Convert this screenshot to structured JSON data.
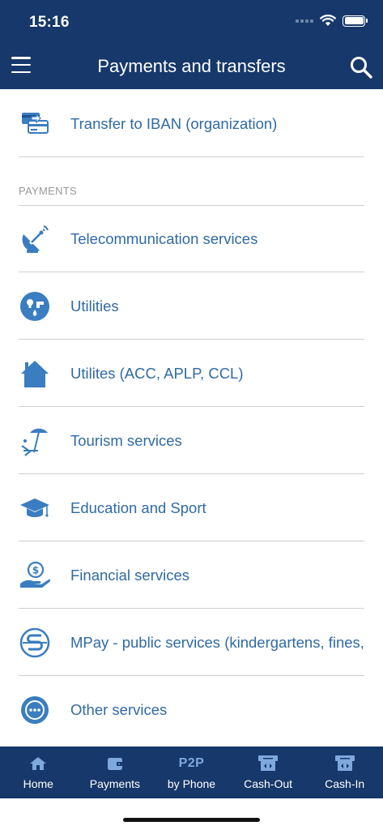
{
  "status_bar": {
    "time": "15:16"
  },
  "header": {
    "title": "Payments and transfers"
  },
  "icons": {
    "menu": "hamburger-menu-icon",
    "search": "search-icon",
    "transfer": "iban-transfer-icon",
    "telecom": "satellite-dish-icon",
    "utilities": "utilities-icon",
    "utilities_acc": "house-icon",
    "tourism": "beach-umbrella-icon",
    "education": "graduation-cap-icon",
    "financial": "hand-coin-icon",
    "mpay": "mpay-logo-icon",
    "other": "more-dots-icon"
  },
  "colors": {
    "brand": "#16386a",
    "link": "#2f6aa6",
    "icon": "#3a7dc0"
  },
  "list": {
    "transfer_iban": "Transfer to IBAN (organization)",
    "section_payments": "PAYMENTS",
    "items": [
      {
        "label": "Telecommunication services"
      },
      {
        "label": "Utilities"
      },
      {
        "label": "Utilites (ACC, APLP, CCL)"
      },
      {
        "label": "Tourism services"
      },
      {
        "label": "Education and Sport"
      },
      {
        "label": "Financial services"
      },
      {
        "label": "MPay - public services (kindergartens, fines, t"
      },
      {
        "label": "Other services"
      }
    ]
  },
  "tabbar": {
    "home": "Home",
    "payments": "Payments",
    "p2p_mark": "P2P",
    "by_phone": "by Phone",
    "cash_out": "Cash-Out",
    "cash_in": "Cash-In"
  }
}
